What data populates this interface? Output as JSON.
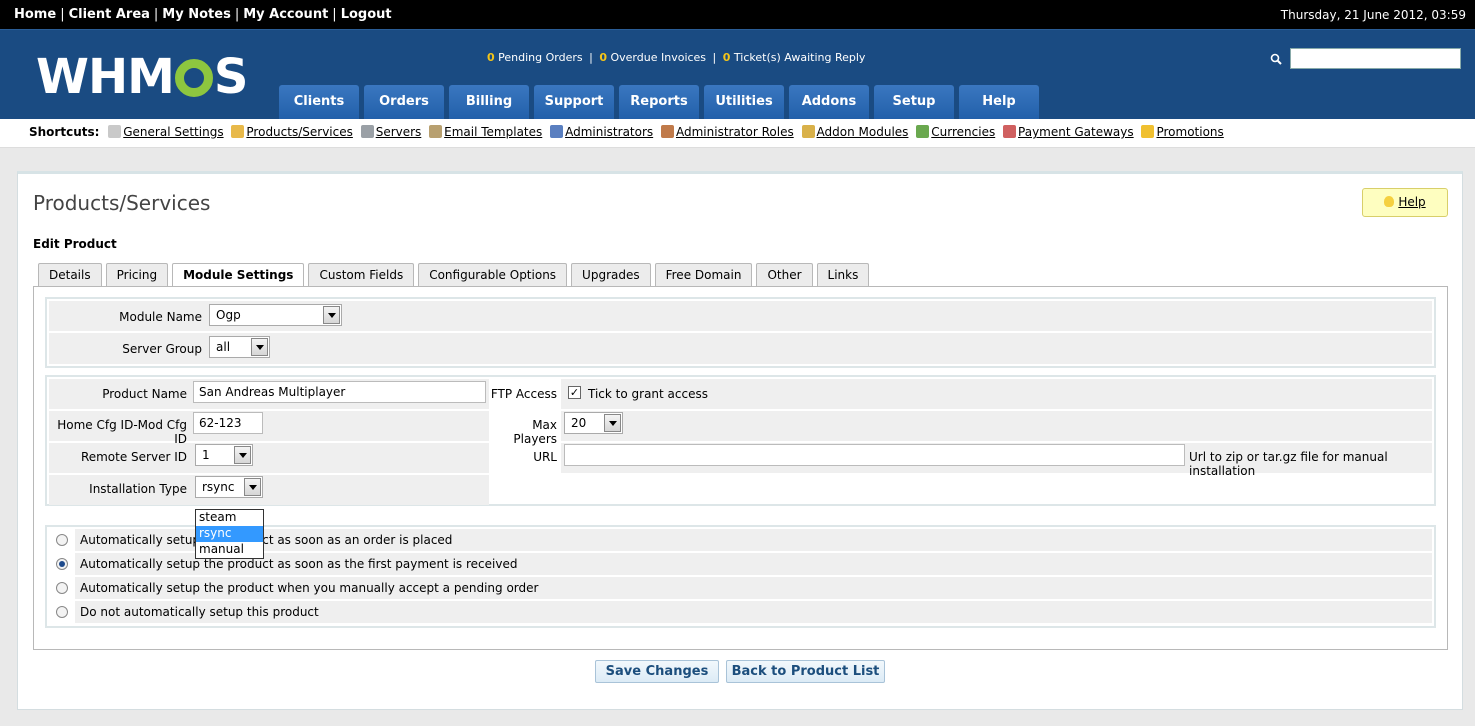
{
  "topnav": {
    "items": [
      "Home",
      "Client Area",
      "My Notes",
      "My Account",
      "Logout"
    ],
    "separator": "|",
    "datetime": "Thursday, 21 June 2012, 03:59"
  },
  "header": {
    "logo_left": "WHM",
    "logo_right": "S",
    "status": {
      "pending_orders_count": "0",
      "pending_orders_label": "Pending Orders",
      "overdue_count": "0",
      "overdue_label": "Overdue Invoices",
      "tickets_count": "0",
      "tickets_label": "Ticket(s) Awaiting Reply",
      "separator": "|"
    },
    "search_placeholder": "",
    "tabs": [
      "Clients",
      "Orders",
      "Billing",
      "Support",
      "Reports",
      "Utilities",
      "Addons",
      "Setup",
      "Help"
    ]
  },
  "shortcuts": {
    "label": "Shortcuts:",
    "items": [
      {
        "label": "General Settings",
        "icon": "settings-doc-icon",
        "color": "#c9c9c9"
      },
      {
        "label": "Products/Services",
        "icon": "box-icon",
        "color": "#e8b94a"
      },
      {
        "label": "Servers",
        "icon": "server-icon",
        "color": "#9aa0a6"
      },
      {
        "label": "Email Templates",
        "icon": "email-template-icon",
        "color": "#b8a070"
      },
      {
        "label": "Administrators",
        "icon": "admin-user-icon",
        "color": "#5a7fc0"
      },
      {
        "label": "Administrator Roles",
        "icon": "admin-roles-icon",
        "color": "#c07a4a"
      },
      {
        "label": "Addon Modules",
        "icon": "addon-box-icon",
        "color": "#d9b14a"
      },
      {
        "label": "Currencies",
        "icon": "currency-icon",
        "color": "#6aa84f"
      },
      {
        "label": "Payment Gateways",
        "icon": "payment-gateway-icon",
        "color": "#d06060"
      },
      {
        "label": "Promotions",
        "icon": "promotion-star-icon",
        "color": "#f0c030"
      }
    ]
  },
  "page": {
    "title": "Products/Services",
    "help_label": "Help",
    "subtitle": "Edit Product",
    "tabs": [
      "Details",
      "Pricing",
      "Module Settings",
      "Custom Fields",
      "Configurable Options",
      "Upgrades",
      "Free Domain",
      "Other",
      "Links"
    ],
    "active_tab": "Module Settings"
  },
  "module": {
    "module_name_label": "Module Name",
    "module_name_value": "Ogp",
    "server_group_label": "Server Group",
    "server_group_value": "all"
  },
  "config": {
    "product_name_label": "Product Name",
    "product_name_value": "San Andreas Multiplayer",
    "home_cfg_label": "Home Cfg ID-Mod Cfg ID",
    "home_cfg_value": "62-123",
    "remote_server_label": "Remote Server ID",
    "remote_server_value": "1",
    "installation_type_label": "Installation Type",
    "installation_type_value": "rsync",
    "installation_options": [
      "steam",
      "rsync",
      "manual"
    ],
    "ftp_access_label": "FTP Access",
    "ftp_access_checked": true,
    "ftp_access_text": "Tick to grant access",
    "max_players_label": "Max Players",
    "max_players_value": "20",
    "url_label": "URL",
    "url_value": "",
    "url_hint": "Url to zip or tar.gz file for manual installation"
  },
  "autosetup": {
    "options": [
      "Automatically setup the product as soon as an order is placed",
      "Automatically setup the product as soon as the first payment is received",
      "Automatically setup the product when you manually accept a pending order",
      "Do not automatically setup this product"
    ],
    "selected_index": 1
  },
  "actions": {
    "save_label": "Save Changes",
    "back_label": "Back to Product List"
  },
  "colors": {
    "header_bg": "#1a4b82",
    "logo_gear": "#8dc63f",
    "status_count": "#f5c518",
    "selected_option_bg": "#3399ff"
  }
}
